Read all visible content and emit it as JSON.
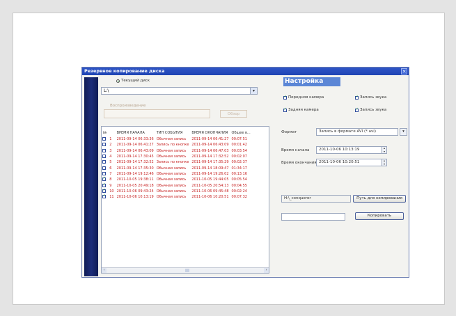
{
  "window": {
    "title": "Резервное копирование диска"
  },
  "source": {
    "radio_label": "Текущий диск",
    "drive_value": "L:\\",
    "playback_label": "Воспроизведение",
    "browse_label": "Обзор"
  },
  "table": {
    "headers": [
      "№",
      "ВРЕМЯ НАЧАЛА",
      "ТИП СОБЫТИЯ",
      "ВРЕМЯ ОКОНЧАНИЯ",
      "Общее в..."
    ],
    "rows": [
      {
        "checked": false,
        "n": "1",
        "start": "2011-09-14 06:33:36",
        "type": "Обычная запись",
        "end": "2011-09-14 06:41:27",
        "total": "00:07:51"
      },
      {
        "checked": false,
        "n": "2",
        "start": "2011-09-14 06:41:27",
        "type": "Запись по кнопке",
        "end": "2011-09-14 06:43:09",
        "total": "00:01:42"
      },
      {
        "checked": false,
        "n": "3",
        "start": "2011-09-14 06:43:09",
        "type": "Обычная запись",
        "end": "2011-09-14 06:47:03",
        "total": "00:03:54"
      },
      {
        "checked": false,
        "n": "4",
        "start": "2011-09-14 17:30:45",
        "type": "Обычная запись",
        "end": "2011-09-14 17:32:52",
        "total": "00:02:07"
      },
      {
        "checked": false,
        "n": "5",
        "start": "2011-09-14 17:32:52",
        "type": "Запись по кнопке",
        "end": "2011-09-14 17:35:29",
        "total": "00:02:37"
      },
      {
        "checked": false,
        "n": "6",
        "start": "2011-09-14 17:35:30",
        "type": "Обычная запись",
        "end": "2011-09-14 18:09:47",
        "total": "01:34:17"
      },
      {
        "checked": false,
        "n": "7",
        "start": "2011-09-14 19:12:46",
        "type": "Обычная запись",
        "end": "2011-09-14 19:26:02",
        "total": "00:13:16"
      },
      {
        "checked": true,
        "n": "8",
        "start": "2011-10-05 19:38:11",
        "type": "Обычная запись",
        "end": "2011-10-05 19:44:05",
        "total": "00:05:54"
      },
      {
        "checked": true,
        "n": "9",
        "start": "2011-10-05 20:49:18",
        "type": "Обычная запись",
        "end": "2011-10-05 20:54:13",
        "total": "00:04:55"
      },
      {
        "checked": true,
        "n": "10",
        "start": "2011-10-06 09:43:24",
        "type": "Обычная запись",
        "end": "2011-10-06 09:45:48",
        "total": "00:02:24"
      },
      {
        "checked": true,
        "n": "11",
        "start": "2011-10-06 10:13:19",
        "type": "Обычная запись",
        "end": "2011-10-06 10:20:51",
        "total": "00:07:32"
      }
    ]
  },
  "settings": {
    "title": "Настройка",
    "front_camera": "Передняя камера",
    "front_audio": "Запись звука",
    "rear_camera": "Задняя камера",
    "rear_audio": "Запись звука",
    "format_label": "Формат",
    "format_value": "Запись в формате AVI (*.avi)",
    "start_label": "Время начала",
    "start_value": "2011-10-06 10:13:19",
    "end_label": "Время окончания",
    "end_value": "2011-10-06 10:20:51",
    "path_value": "H:\\_conqueror",
    "path_button": "Путь для копирования",
    "copy_button": "Копировать"
  }
}
